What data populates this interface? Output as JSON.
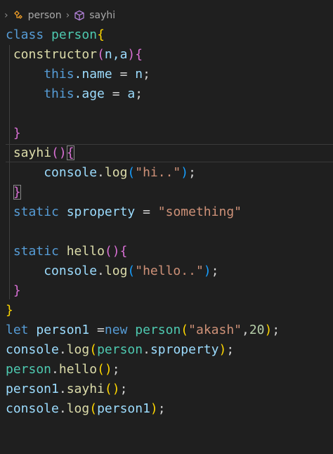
{
  "breadcrumb": {
    "items": [
      {
        "icon": "class-icon",
        "label": "person"
      },
      {
        "icon": "method-icon",
        "label": "sayhi"
      }
    ]
  },
  "code": {
    "l1": {
      "a": "class",
      "b": "person",
      "c": "{"
    },
    "l2": {
      "a": "constructor",
      "b": "(",
      "c": "n,a",
      "d": ")",
      "e": "{"
    },
    "l3": {
      "a": "this",
      "b": ".name",
      "c": " = ",
      "d": "n",
      "e": ";"
    },
    "l4": {
      "a": "this",
      "b": ".age",
      "c": " = ",
      "d": "a",
      "e": ";"
    },
    "l6": {
      "a": "}"
    },
    "l7": {
      "a": "sayhi",
      "b": "(",
      "c": ")",
      "d": "{"
    },
    "l8": {
      "a": "console",
      "b": ".",
      "c": "log",
      "d": "(",
      "e": "\"hi..\"",
      "f": ")",
      "g": ";"
    },
    "l9": {
      "a": "}"
    },
    "l10": {
      "a": "static",
      "b": "sproperty",
      "c": " = ",
      "d": "\"something\""
    },
    "l12": {
      "a": "static",
      "b": "hello",
      "c": "(",
      "d": ")",
      "e": "{"
    },
    "l13": {
      "a": "console",
      "b": ".",
      "c": "log",
      "d": "(",
      "e": "\"hello..\"",
      "f": ")",
      "g": ";"
    },
    "l14": {
      "a": "}"
    },
    "l15": {
      "a": "}"
    },
    "l16": {
      "a": "let",
      "b": "person1",
      "c": " =",
      "d": "new",
      "e": "person",
      "f": "(",
      "g": "\"akash\"",
      "h": ",",
      "i": "20",
      "j": ")",
      "k": ";"
    },
    "l17": {
      "a": "console",
      "b": ".",
      "c": "log",
      "d": "(",
      "e": "person",
      "f": ".",
      "g": "sproperty",
      "h": ")",
      "i": ";"
    },
    "l18": {
      "a": "person",
      "b": ".",
      "c": "hello",
      "d": "(",
      "e": ")",
      "f": ";"
    },
    "l19": {
      "a": "person1",
      "b": ".",
      "c": "sayhi",
      "d": "(",
      "e": ")",
      "f": ";"
    },
    "l20": {
      "a": "console",
      "b": ".",
      "c": "log",
      "d": "(",
      "e": "person1",
      "f": ")",
      "g": ";"
    }
  }
}
